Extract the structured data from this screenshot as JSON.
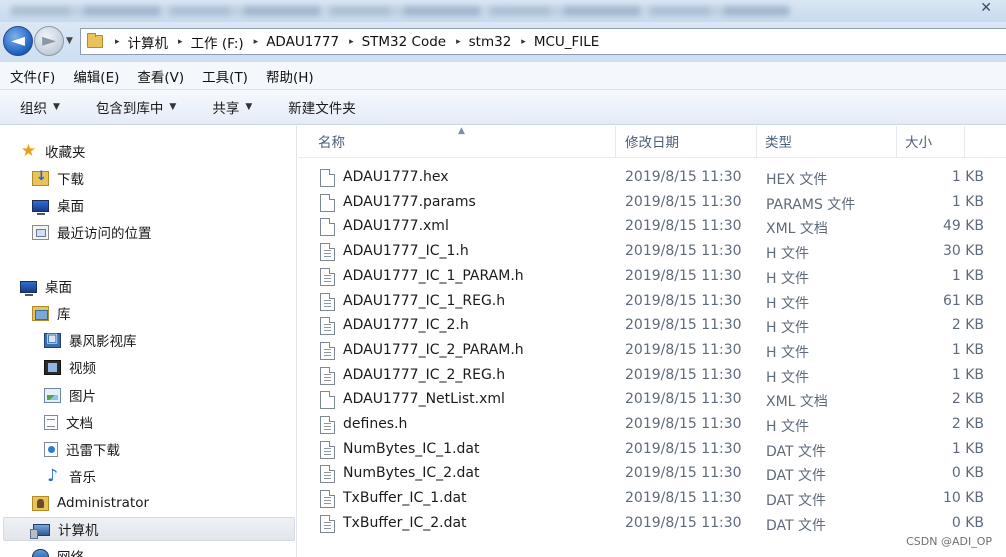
{
  "window": {
    "close_glyph": "✕"
  },
  "address": {
    "crumbs": [
      "计算机",
      "工作 (F:)",
      "ADAU1777",
      "STM32 Code",
      "stm32",
      "MCU_FILE"
    ],
    "separator": "▸"
  },
  "menu": [
    "文件(F)",
    "编辑(E)",
    "查看(V)",
    "工具(T)",
    "帮助(H)"
  ],
  "toolbar": [
    {
      "label": "组织",
      "caret": "▼"
    },
    {
      "label": "包含到库中",
      "caret": "▼"
    },
    {
      "label": "共享",
      "caret": "▼"
    },
    {
      "label": "新建文件夹",
      "caret": ""
    }
  ],
  "nav": {
    "favorites": {
      "label": "收藏夹",
      "icon": "star-icon"
    },
    "favorite_items": [
      {
        "label": "下载",
        "icon": "download-folder-icon"
      },
      {
        "label": "桌面",
        "icon": "desktop-icon"
      },
      {
        "label": "最近访问的位置",
        "icon": "recent-places-icon"
      }
    ],
    "desktop": {
      "label": "桌面",
      "icon": "desktop-icon"
    },
    "library": {
      "label": "库",
      "icon": "library-icon"
    },
    "library_items": [
      {
        "label": "暴风影视库",
        "icon": "video-library-icon"
      },
      {
        "label": "视频",
        "icon": "film-icon"
      },
      {
        "label": "图片",
        "icon": "picture-icon"
      },
      {
        "label": "文档",
        "icon": "document-icon"
      },
      {
        "label": "迅雷下载",
        "icon": "thunder-download-icon"
      },
      {
        "label": "音乐",
        "icon": "music-note-icon"
      }
    ],
    "administrator": {
      "label": "Administrator",
      "icon": "user-folder-icon"
    },
    "computer": {
      "label": "计算机",
      "icon": "computer-icon"
    },
    "network": {
      "label": "网络",
      "icon": "network-icon"
    }
  },
  "columns": {
    "name": "名称",
    "date": "修改日期",
    "type": "类型",
    "size": "大小",
    "sort_indicator": "▲"
  },
  "files": [
    {
      "name": "ADAU1777.hex",
      "date": "2019/8/15 11:30",
      "type": "HEX 文件",
      "size": "1 KB",
      "icon": "blank-file-icon"
    },
    {
      "name": "ADAU1777.params",
      "date": "2019/8/15 11:30",
      "type": "PARAMS 文件",
      "size": "1 KB",
      "icon": "blank-file-icon"
    },
    {
      "name": "ADAU1777.xml",
      "date": "2019/8/15 11:30",
      "type": "XML 文档",
      "size": "49 KB",
      "icon": "blank-file-icon"
    },
    {
      "name": "ADAU1777_IC_1.h",
      "date": "2019/8/15 11:30",
      "type": "H 文件",
      "size": "30 KB",
      "icon": "text-file-icon"
    },
    {
      "name": "ADAU1777_IC_1_PARAM.h",
      "date": "2019/8/15 11:30",
      "type": "H 文件",
      "size": "1 KB",
      "icon": "text-file-icon"
    },
    {
      "name": "ADAU1777_IC_1_REG.h",
      "date": "2019/8/15 11:30",
      "type": "H 文件",
      "size": "61 KB",
      "icon": "text-file-icon"
    },
    {
      "name": "ADAU1777_IC_2.h",
      "date": "2019/8/15 11:30",
      "type": "H 文件",
      "size": "2 KB",
      "icon": "text-file-icon"
    },
    {
      "name": "ADAU1777_IC_2_PARAM.h",
      "date": "2019/8/15 11:30",
      "type": "H 文件",
      "size": "1 KB",
      "icon": "text-file-icon"
    },
    {
      "name": "ADAU1777_IC_2_REG.h",
      "date": "2019/8/15 11:30",
      "type": "H 文件",
      "size": "1 KB",
      "icon": "text-file-icon"
    },
    {
      "name": "ADAU1777_NetList.xml",
      "date": "2019/8/15 11:30",
      "type": "XML 文档",
      "size": "2 KB",
      "icon": "blank-file-icon"
    },
    {
      "name": "defines.h",
      "date": "2019/8/15 11:30",
      "type": "H 文件",
      "size": "2 KB",
      "icon": "text-file-icon"
    },
    {
      "name": "NumBytes_IC_1.dat",
      "date": "2019/8/15 11:30",
      "type": "DAT 文件",
      "size": "1 KB",
      "icon": "text-file-icon"
    },
    {
      "name": "NumBytes_IC_2.dat",
      "date": "2019/8/15 11:30",
      "type": "DAT 文件",
      "size": "0 KB",
      "icon": "text-file-icon"
    },
    {
      "name": "TxBuffer_IC_1.dat",
      "date": "2019/8/15 11:30",
      "type": "DAT 文件",
      "size": "10 KB",
      "icon": "text-file-icon"
    },
    {
      "name": "TxBuffer_IC_2.dat",
      "date": "2019/8/15 11:30",
      "type": "DAT 文件",
      "size": "0 KB",
      "icon": "text-file-icon"
    }
  ],
  "watermark": "CSDN @ADI_OP"
}
